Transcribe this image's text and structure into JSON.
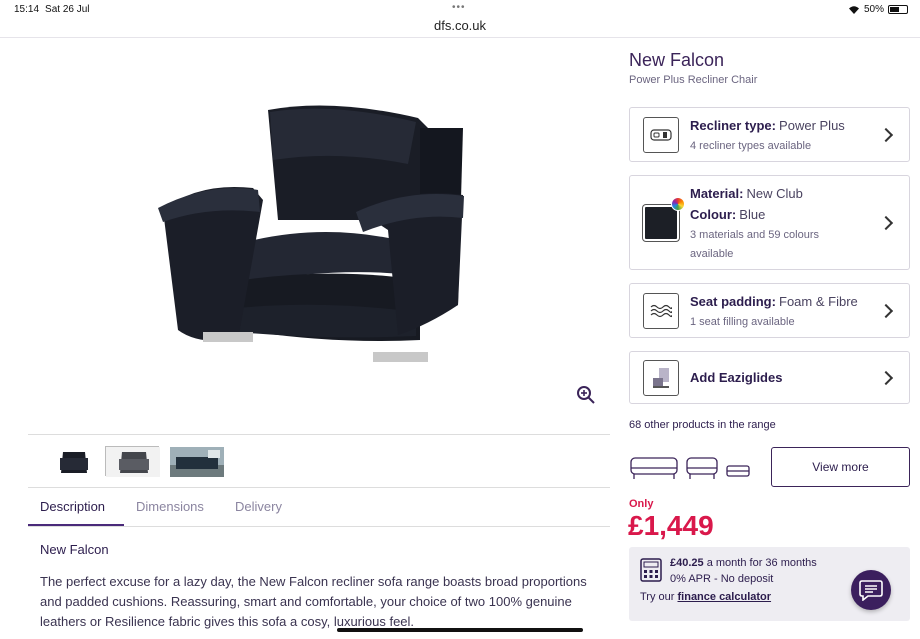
{
  "status_bar": {
    "time": "15:14",
    "date": "Sat 26 Jul",
    "url": "dfs.co.uk",
    "battery": "50%"
  },
  "product": {
    "title": "New Falcon",
    "subtitle": "Power Plus Recliner Chair"
  },
  "options": {
    "recliner": {
      "label": "Recliner type:",
      "value": "Power Plus",
      "detail": "4 recliner types available",
      "icon": "recliner-remote-icon"
    },
    "material": {
      "material_label": "Material:",
      "material_value": "New Club",
      "colour_label": "Colour:",
      "colour_value": "Blue",
      "detail": "3 materials and 59 colours available",
      "swatch_color": "#1c1f26",
      "icon": "fabric-swatch-icon"
    },
    "padding": {
      "label": "Seat padding:",
      "value": "Foam & Fibre",
      "detail": "1 seat filling available",
      "icon": "waves-icon"
    },
    "eaziglides": {
      "label": "Add Eaziglides",
      "icon": "eaziglides-icon"
    }
  },
  "range": {
    "text": "68 other products in the range",
    "view_more": "View more"
  },
  "price": {
    "only": "Only",
    "amount": "£1,449"
  },
  "finance": {
    "monthly": "£40.25",
    "monthly_suffix": "a month for 36 months",
    "apr": "0% APR - No deposit",
    "try_prefix": "Try our",
    "link": "finance calculator"
  },
  "tabs": [
    {
      "label": "Description"
    },
    {
      "label": "Dimensions"
    },
    {
      "label": "Delivery"
    }
  ],
  "description": {
    "title": "New Falcon",
    "text": "The perfect excuse for a lazy day, the New Falcon recliner sofa range boasts broad proportions and padded cushions. Reassuring, smart and comfortable, your choice of two 100% genuine leathers or Resilience fabric gives this sofa a cosy, luxurious feel."
  },
  "colors": {
    "brand_purple": "#3b2459",
    "price_red": "#d9184b"
  }
}
